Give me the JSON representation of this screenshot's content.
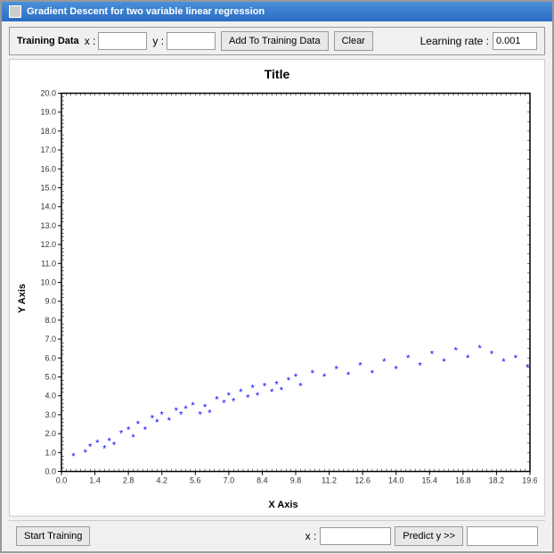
{
  "window": {
    "title": "Gradient Descent for two variable linear regression"
  },
  "training_data": {
    "section_label": "Training Data",
    "x_label": "x :",
    "y_label": "y :",
    "x_value": "",
    "y_value": "",
    "add_button_label": "Add To Training Data",
    "clear_button_label": "Clear",
    "learning_rate_label": "Learning rate :",
    "learning_rate_value": "0.001"
  },
  "chart": {
    "title": "Title",
    "y_axis_label": "Y Axis",
    "x_axis_label": "X Axis",
    "y_ticks": [
      "20.0",
      "19.0",
      "18.0",
      "17.0",
      "16.0",
      "15.0",
      "14.0",
      "13.0",
      "12.0",
      "11.0",
      "10.0",
      "9.0",
      "8.0",
      "7.0",
      "6.0",
      "5.0",
      "4.0",
      "3.0",
      "2.0",
      "1.0",
      "0.0"
    ],
    "x_ticks": [
      "0.0",
      "1.4",
      "2.8",
      "4.2",
      "5.6",
      "7.0",
      "8.4",
      "9.8",
      "11.2",
      "12.6",
      "14.0",
      "15.4",
      "16.8",
      "18.2",
      "19.6"
    ],
    "data_points": [
      [
        0.5,
        0.8
      ],
      [
        1.0,
        1.0
      ],
      [
        1.2,
        1.3
      ],
      [
        1.5,
        1.5
      ],
      [
        1.8,
        1.2
      ],
      [
        2.0,
        1.6
      ],
      [
        2.2,
        1.4
      ],
      [
        2.5,
        2.0
      ],
      [
        2.8,
        2.2
      ],
      [
        3.0,
        1.8
      ],
      [
        3.2,
        2.5
      ],
      [
        3.5,
        2.2
      ],
      [
        3.8,
        2.8
      ],
      [
        4.0,
        2.6
      ],
      [
        4.2,
        3.0
      ],
      [
        4.5,
        2.7
      ],
      [
        4.8,
        3.2
      ],
      [
        5.0,
        3.0
      ],
      [
        5.2,
        3.3
      ],
      [
        5.5,
        3.5
      ],
      [
        5.8,
        3.0
      ],
      [
        6.0,
        3.4
      ],
      [
        6.2,
        3.1
      ],
      [
        6.5,
        3.8
      ],
      [
        6.8,
        3.6
      ],
      [
        7.0,
        4.0
      ],
      [
        7.2,
        3.7
      ],
      [
        7.5,
        4.2
      ],
      [
        7.8,
        3.9
      ],
      [
        8.0,
        4.4
      ],
      [
        8.2,
        4.0
      ],
      [
        8.5,
        4.5
      ],
      [
        8.8,
        4.2
      ],
      [
        9.0,
        4.6
      ],
      [
        9.2,
        4.3
      ],
      [
        9.5,
        4.8
      ],
      [
        9.8,
        5.0
      ],
      [
        10.0,
        4.5
      ],
      [
        10.5,
        5.2
      ],
      [
        11.0,
        5.0
      ],
      [
        11.5,
        5.4
      ],
      [
        12.0,
        5.1
      ],
      [
        12.5,
        5.6
      ],
      [
        13.0,
        5.2
      ],
      [
        13.5,
        5.8
      ],
      [
        14.0,
        5.4
      ],
      [
        14.5,
        6.0
      ],
      [
        15.0,
        5.6
      ],
      [
        15.5,
        6.2
      ],
      [
        16.0,
        5.8
      ],
      [
        16.5,
        6.4
      ],
      [
        17.0,
        6.0
      ],
      [
        17.5,
        6.5
      ],
      [
        18.0,
        6.2
      ],
      [
        18.5,
        5.8
      ],
      [
        19.0,
        6.0
      ],
      [
        19.5,
        5.5
      ]
    ],
    "x_min": 0,
    "x_max": 19.6,
    "y_min": 0,
    "y_max": 20.0
  },
  "bottom": {
    "start_training_label": "Start Training",
    "x_label": "x :",
    "x_value": "",
    "predict_button_label": "Predict y >>",
    "predict_output": ""
  }
}
